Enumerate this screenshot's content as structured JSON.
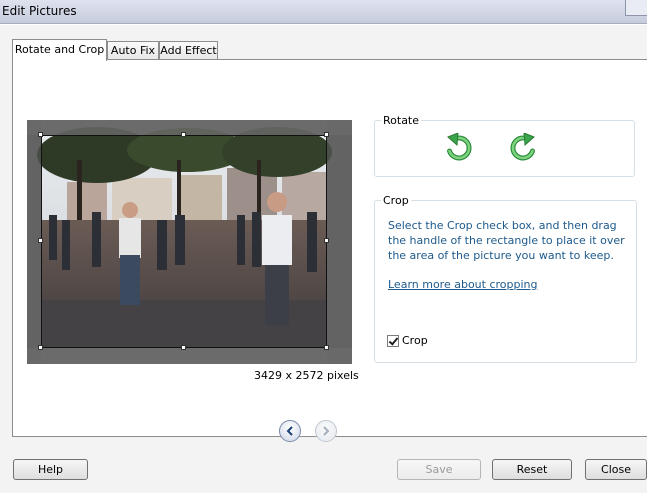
{
  "window": {
    "title": "Edit Pictures"
  },
  "tabs": [
    {
      "label": "Rotate and Crop",
      "active": true
    },
    {
      "label": "Auto Fix",
      "active": false
    },
    {
      "label": "Add Effect",
      "active": false
    }
  ],
  "preview": {
    "dimensions": "3429 x 2572 pixels"
  },
  "rotate": {
    "label": "Rotate",
    "left_icon": "rotate-left-icon",
    "right_icon": "rotate-right-icon"
  },
  "crop": {
    "label": "Crop",
    "help_text": "Select the Crop check box, and then drag the handle of the rectangle to place it over the area of the picture you want to keep.",
    "link_text": "Learn more about cropping",
    "checkbox_label": "Crop",
    "checkbox_checked": true
  },
  "buttons": {
    "help": "Help",
    "save": "Save",
    "reset": "Reset",
    "close": "Close"
  },
  "colors": {
    "accent_text": "#1e5a8c",
    "rotate_green": "#3aa44a"
  }
}
